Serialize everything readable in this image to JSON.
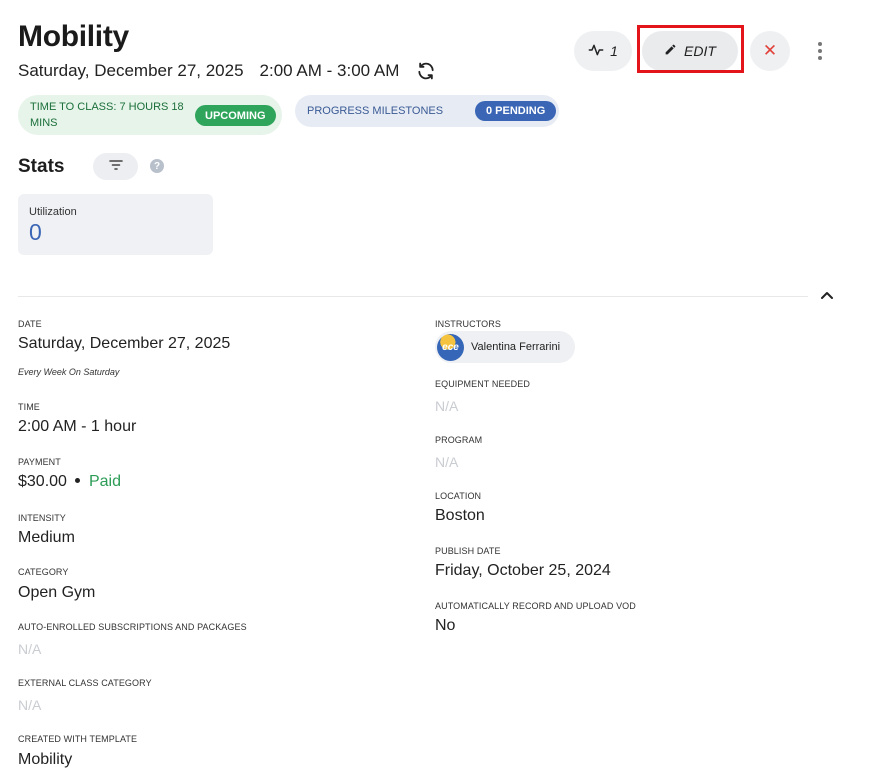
{
  "header": {
    "title": "Mobility",
    "date": "Saturday, December 27, 2025",
    "time_range": "2:00 AM - 3:00 AM",
    "activity_count": "1",
    "edit_label": "EDIT"
  },
  "status": {
    "time_to_class": "TIME TO CLASS: 7 HOURS 18 MINS",
    "upcoming_badge": "UPCOMING",
    "progress_label": "PROGRESS MILESTONES",
    "pending_badge": "0 PENDING"
  },
  "stats": {
    "title": "Stats",
    "utilization_label": "Utilization",
    "utilization_value": "0"
  },
  "details": {
    "date_label": "DATE",
    "date_value": "Saturday, December 27, 2025",
    "recurrence": "Every Week On Saturday",
    "time_label": "TIME",
    "time_value": "2:00 AM - 1 hour",
    "payment_label": "PAYMENT",
    "payment_amount": "$30.00",
    "payment_status": "Paid",
    "intensity_label": "INTENSITY",
    "intensity_value": "Medium",
    "category_label": "CATEGORY",
    "category_value": "Open Gym",
    "auto_enrolled_label": "AUTO-ENROLLED SUBSCRIPTIONS AND PACKAGES",
    "auto_enrolled_value": "N/A",
    "external_category_label": "EXTERNAL CLASS CATEGORY",
    "external_category_value": "N/A",
    "template_label": "CREATED WITH TEMPLATE",
    "template_value": "Mobility",
    "instructors_label": "INSTRUCTORS",
    "instructor_name": "Valentina Ferrarini",
    "instructor_avatar_text": "ece",
    "equipment_label": "EQUIPMENT NEEDED",
    "equipment_value": "N/A",
    "program_label": "PROGRAM",
    "program_value": "N/A",
    "location_label": "LOCATION",
    "location_value": "Boston",
    "publish_label": "PUBLISH DATE",
    "publish_value": "Friday, October 25, 2024",
    "auto_record_label": "AUTOMATICALLY RECORD AND UPLOAD VOD",
    "auto_record_value": "No"
  },
  "colors": {
    "accent_blue": "#3a66b5",
    "success_green": "#2fa45b",
    "close_red": "#e2413a",
    "highlight_red": "#e3151a"
  },
  "icons": [
    "sync-icon",
    "activity-icon",
    "pencil-icon",
    "close-icon",
    "more-vertical-icon",
    "filter-icon",
    "help-icon",
    "chevron-up-icon"
  ]
}
